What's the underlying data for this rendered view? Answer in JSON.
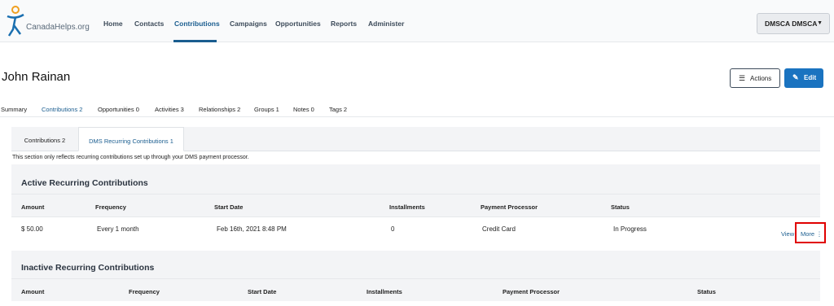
{
  "brand": {
    "name": "CanadaHelps.org"
  },
  "nav": {
    "items": [
      {
        "label": "Home"
      },
      {
        "label": "Contacts"
      },
      {
        "label": "Contributions"
      },
      {
        "label": "Campaigns"
      },
      {
        "label": "Opportunities"
      },
      {
        "label": "Reports"
      },
      {
        "label": "Administer"
      }
    ],
    "active": "Contributions",
    "user_label": "DMSCA DMSCA"
  },
  "page": {
    "title": "John Rainan",
    "actions_label": "Actions",
    "edit_label": "Edit"
  },
  "contact_tabs": [
    {
      "label": "Summary"
    },
    {
      "label": "Contributions 2"
    },
    {
      "label": "Opportunities 0"
    },
    {
      "label": "Activities 3"
    },
    {
      "label": "Relationships 2"
    },
    {
      "label": "Groups 1"
    },
    {
      "label": "Notes 0"
    },
    {
      "label": "Tags 2"
    }
  ],
  "sub_tabs": [
    {
      "label": "Contributions 2"
    },
    {
      "label": "DMS Recurring Contributions 1"
    }
  ],
  "info_text": "This section only reflects recurring contributions set up through your DMS payment processor.",
  "active_section": {
    "title": "Active Recurring Contributions",
    "columns": [
      "Amount",
      "Frequency",
      "Start Date",
      "Installments",
      "Payment Processor",
      "Status"
    ],
    "rows": [
      {
        "amount": "$ 50.00",
        "frequency": "Every 1 month",
        "start_date": "Feb 16th, 2021 8:48 PM",
        "installments": "0",
        "payment_processor": "Credit Card",
        "status": "In Progress",
        "view_label": "View",
        "more_label": "More"
      }
    ]
  },
  "inactive_section": {
    "title": "Inactive Recurring Contributions",
    "columns": [
      "Amount",
      "Frequency",
      "Start Date",
      "Installments",
      "Payment Processor",
      "Status"
    ]
  },
  "colors": {
    "accent": "#1a5d8f",
    "primary_button": "#1a73c0",
    "highlight": "#e00000"
  },
  "icons": {
    "logo": "stick-figure-logo-icon",
    "caret": "caret-down-icon",
    "actions": "list-icon",
    "edit": "pencil-icon",
    "more": "vertical-dots-icon"
  }
}
